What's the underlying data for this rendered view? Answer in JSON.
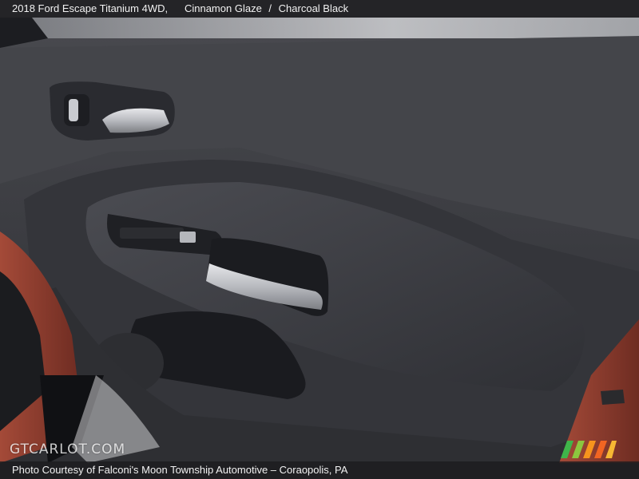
{
  "header": {
    "title": "2018 Ford Escape Titanium 4WD,",
    "exterior_color": "Cinnamon Glaze",
    "separator": "/",
    "interior_color": "Charcoal Black"
  },
  "footer": {
    "caption": "Photo Courtesy of Falconi's Moon Township Automotive – Coraopolis, PA"
  },
  "watermark": {
    "text": "GTCARLOT.COM"
  },
  "logo": {
    "icon": "gtcarlot-stripes-logo",
    "colors": [
      "#3fb54a",
      "#8cc63f",
      "#f7941d",
      "#f26522"
    ]
  },
  "photo": {
    "subject": "door-panel-interior",
    "colors": {
      "panel": "#3a3b40",
      "panel_dark": "#1f2024",
      "body_paint": "#8a3a2c",
      "chrome": "#c9cbd0"
    }
  }
}
